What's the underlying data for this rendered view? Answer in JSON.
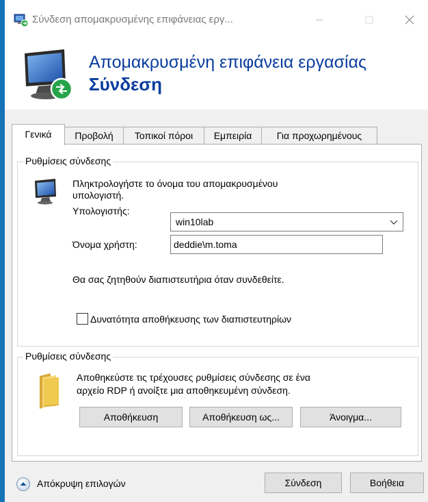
{
  "titlebar": {
    "title": "Σύνδεση απομακρυσμένης επιφάνειας εργ..."
  },
  "header": {
    "line1": "Απομακρυσμένη επιφάνεια εργασίας",
    "line2": "Σύνδεση"
  },
  "tabs": [
    {
      "label": "Γενικά",
      "active": true
    },
    {
      "label": "Προβολή"
    },
    {
      "label": "Τοπικοί πόροι"
    },
    {
      "label": "Εμπειρία"
    },
    {
      "label": "Για προχωρημένους"
    }
  ],
  "logon": {
    "group_title": "Ρυθμίσεις σύνδεσης",
    "instruction_line1": "Πληκτρολογήστε το όνομα του απομακρυσμένου",
    "instruction_line2": "υπολογιστή.",
    "computer_label": "Υπολογιστής:",
    "computer_value": "win10lab",
    "username_label": "Όνομα χρήστη:",
    "username_value": "deddie\\m.toma",
    "credentials_note": "Θα σας ζητηθούν διαπιστευτήρια όταν συνδεθείτε.",
    "save_credentials_label": "Δυνατότητα αποθήκευσης των διαπιστευτηρίων",
    "save_credentials_checked": false
  },
  "settings": {
    "group_title": "Ρυθμίσεις σύνδεσης",
    "description_line1": "Αποθηκεύστε τις τρέχουσες ρυθμίσεις σύνδεσης σε ένα",
    "description_line2": "αρχείο RDP ή ανοίξτε μια αποθηκευμένη σύνδεση.",
    "save_label": "Αποθήκευση",
    "save_as_label": "Αποθήκευση ως...",
    "open_label": "Άνοιγμα..."
  },
  "footer": {
    "hide_options_label": "Απόκρυψη επιλογών",
    "connect_label": "Σύνδεση",
    "help_label": "Βοήθεια"
  },
  "colors": {
    "desktop": "#1573b8",
    "header_text": "#0a3d9e",
    "dialog_bg": "#f0f0f0"
  },
  "icons": {
    "title": "remote-desktop-icon",
    "header": "remote-desktop-monitor-icon",
    "computer": "computer-monitor-icon",
    "folder": "folder-icon",
    "hide_options": "chevron-up-circle-icon"
  }
}
